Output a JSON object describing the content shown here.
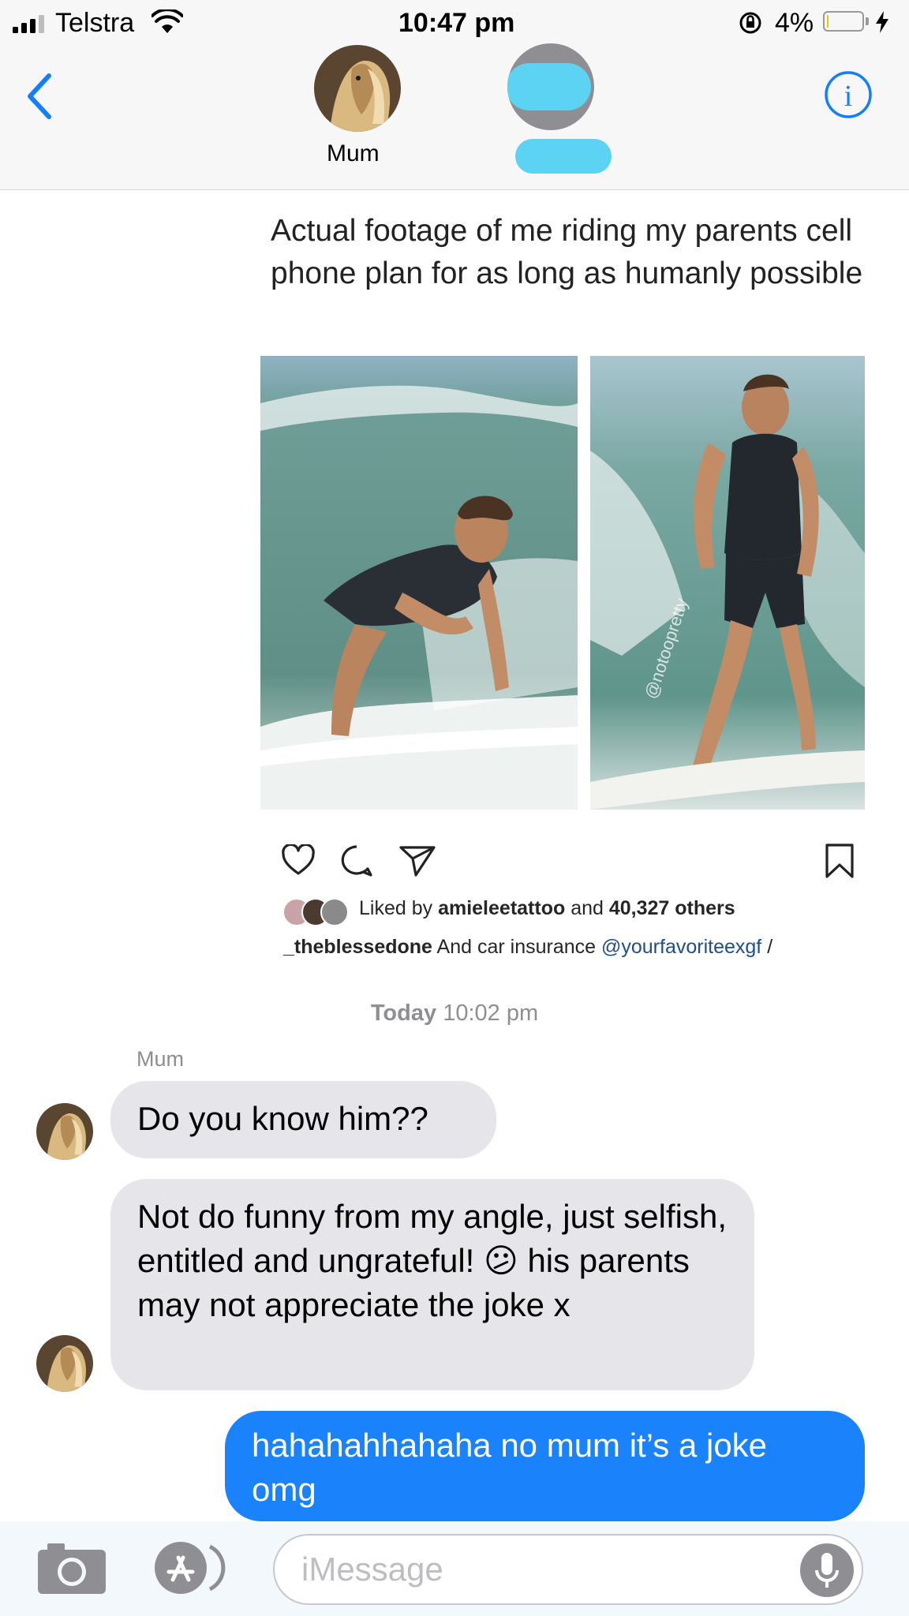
{
  "status_bar": {
    "carrier": "Telstra",
    "time": "10:47 pm",
    "battery": "4%",
    "battery_level": 0.04
  },
  "header": {
    "contact_1": "Mum"
  },
  "post": {
    "caption": "Actual footage of me riding my parents cell phone plan for as long as humanly possible",
    "watermark": "@notoopretty",
    "liked_prefix": "Liked by",
    "liked_user": "amieleetattoo",
    "liked_middle": "and",
    "liked_count": "40,327 others",
    "comment_user": "_theblessedone",
    "comment_text": "And car insurance",
    "comment_mention": "@yourfavoriteexgf",
    "comment_suffix": "/"
  },
  "thread": {
    "timestamp_day": "Today",
    "timestamp_time": "10:02 pm",
    "sender_name": "Mum",
    "messages": [
      {
        "from": "Mum",
        "text": "Do you know him??"
      },
      {
        "from": "Mum",
        "text": "Not do funny from my angle, just selfish, entitled and ungrateful! 😕 his parents may not appreciate the joke x"
      },
      {
        "from": "me",
        "text": "hahahahhahaha no mum it’s a joke omg"
      }
    ]
  },
  "input": {
    "placeholder": "iMessage"
  },
  "colors": {
    "imessage_blue": "#1a82fb",
    "received_gray": "#e5e5ea",
    "ios_blue": "#147efb",
    "redaction": "#5dd3f3"
  }
}
